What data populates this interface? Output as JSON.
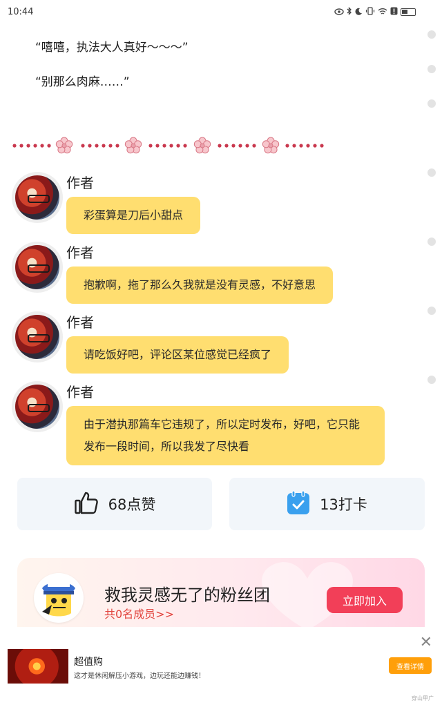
{
  "status_bar": {
    "time": "10:44",
    "icons": [
      "eye-icon",
      "bluetooth-icon",
      "moon-icon",
      "vibrate-icon",
      "wifi-icon",
      "alert-icon",
      "battery-icon"
    ]
  },
  "story": {
    "lines": [
      "“嘻嘻，执法大人真好～～～”",
      "“别那么肉麻……”"
    ]
  },
  "comments": [
    {
      "name": "作者",
      "text": "彩蛋算是刀后小甜点"
    },
    {
      "name": "作者",
      "text": "抱歉啊，拖了那么久我就是没有灵感，不好意思"
    },
    {
      "name": "作者",
      "text": "请吃饭好吧，评论区某位感觉已经疯了"
    },
    {
      "name": "作者",
      "text": "由于潜执那篇车它违规了，所以定时发布，好吧，它只能发布一段时间，所以我发了尽快看"
    }
  ],
  "actions": {
    "like_label": "68点赞",
    "checkin_label": "13打卡",
    "accent": "#3aa0ee"
  },
  "fan_club": {
    "title": "救我灵感无了的粉丝团",
    "members": "共0名成员>>",
    "join_label": "立即加入",
    "button_color": "#f23f58"
  },
  "ad": {
    "title": "超值购",
    "description": "这才是休闲解压小游戏，边玩还能边赚钱！",
    "button_label": "查看详情",
    "tag": "穿山甲广"
  }
}
